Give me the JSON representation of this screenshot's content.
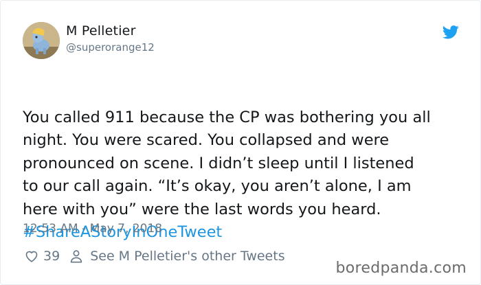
{
  "author": {
    "display_name": "M Pelletier",
    "handle": "@superorange12"
  },
  "tweet": {
    "text": "You called 911 because the CP was bothering you all\nnight. You were scared. You collapsed and were\npronounced on scene. I didn’t sleep until I listened\nto our call again. “It’s okay, you aren’t alone, I am\nhere with you” were the last words you heard.",
    "hashtag": "#ShareAStoryInOneTweet",
    "timestamp": "12:53 AM - May 7, 2018"
  },
  "actions": {
    "like_count": "39",
    "profile_link": "See M Pelletier's other Tweets"
  },
  "icons": {
    "brand": "twitter-bird-icon",
    "like": "heart-icon",
    "profile": "person-icon"
  },
  "watermark": "boredpanda.com",
  "colors": {
    "link": "#1b95e0",
    "muted": "#657786",
    "text": "#14171a",
    "twitter_blue": "#1da1f2"
  }
}
